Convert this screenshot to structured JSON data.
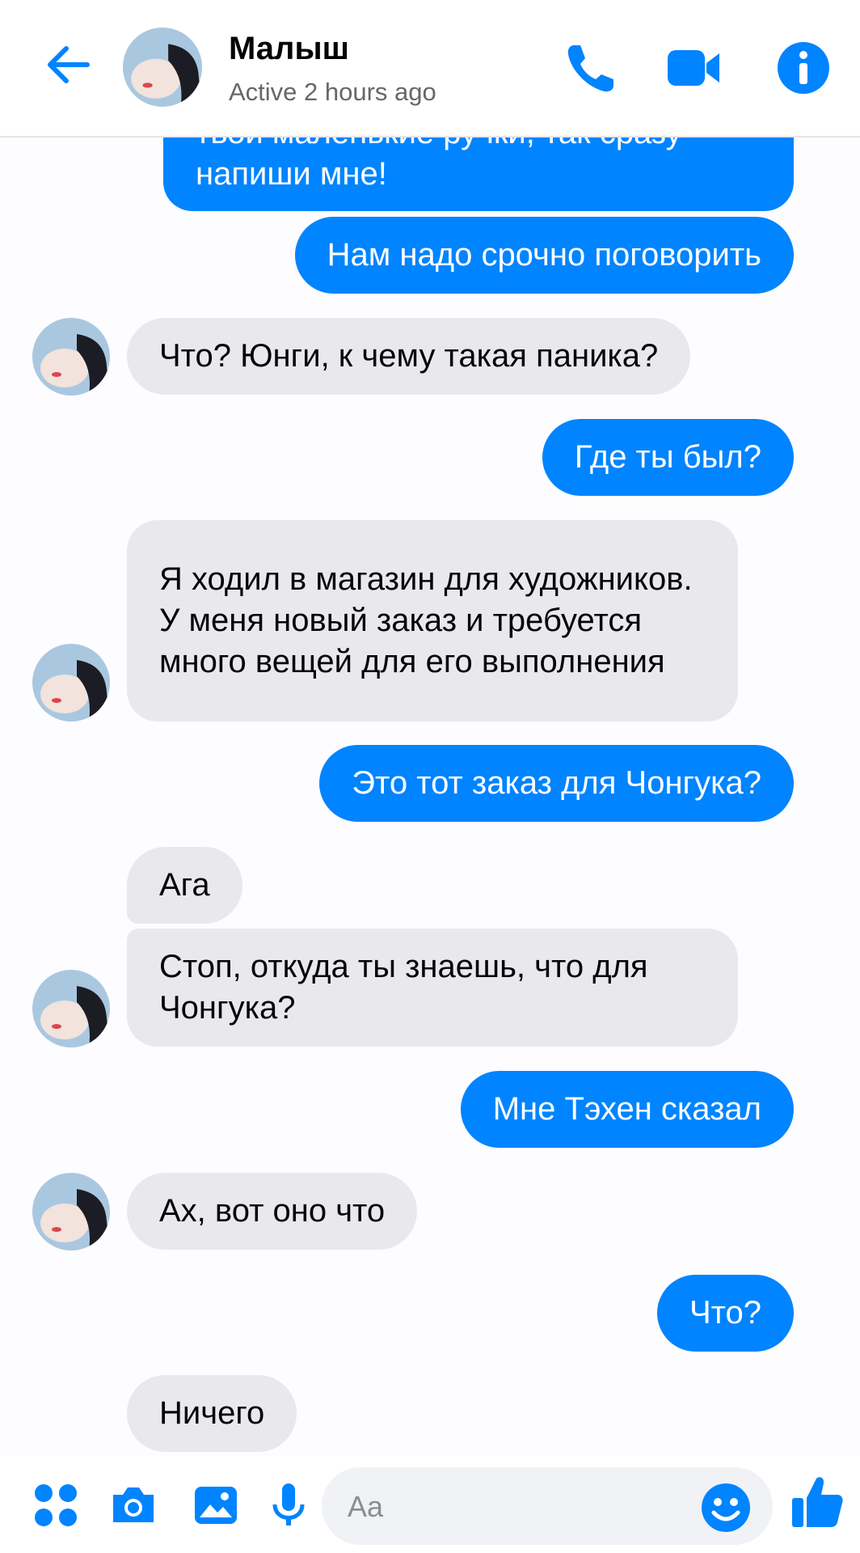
{
  "colors": {
    "accent": "#0084ff",
    "incoming_bubble": "#e9e8ed",
    "background": "#fdfcfe"
  },
  "header": {
    "title": "Малыш",
    "status": "Active 2 hours ago",
    "icons": [
      "back-arrow-icon",
      "phone-icon",
      "video-camera-icon",
      "info-icon"
    ]
  },
  "messages": [
    {
      "side": "out",
      "text": "твои маленькие ручки, так сразу напиши мне!"
    },
    {
      "side": "out",
      "text": "Нам надо срочно поговорить"
    },
    {
      "side": "in",
      "text": "Что? Юнги, к чему такая паника?"
    },
    {
      "side": "out",
      "text": "Где ты был?"
    },
    {
      "side": "in",
      "text": "Я ходил в магазин для художников. У меня новый заказ и требуется много вещей для его выполнения"
    },
    {
      "side": "out",
      "text": "Это тот заказ для Чонгука?"
    },
    {
      "side": "in",
      "text": "Ага"
    },
    {
      "side": "in",
      "text": "Стоп, откуда ты знаешь, что для Чонгука?"
    },
    {
      "side": "out",
      "text": "Мне Тэхен сказал"
    },
    {
      "side": "in",
      "text": "Ах, вот оно что"
    },
    {
      "side": "out",
      "text": "Что?"
    },
    {
      "side": "in",
      "text": "Ничего"
    }
  ],
  "composer": {
    "placeholder": "Aa",
    "icons": [
      "menu-dots-icon",
      "camera-icon",
      "gallery-icon",
      "microphone-icon",
      "emoji-icon",
      "thumbs-up-icon"
    ]
  }
}
